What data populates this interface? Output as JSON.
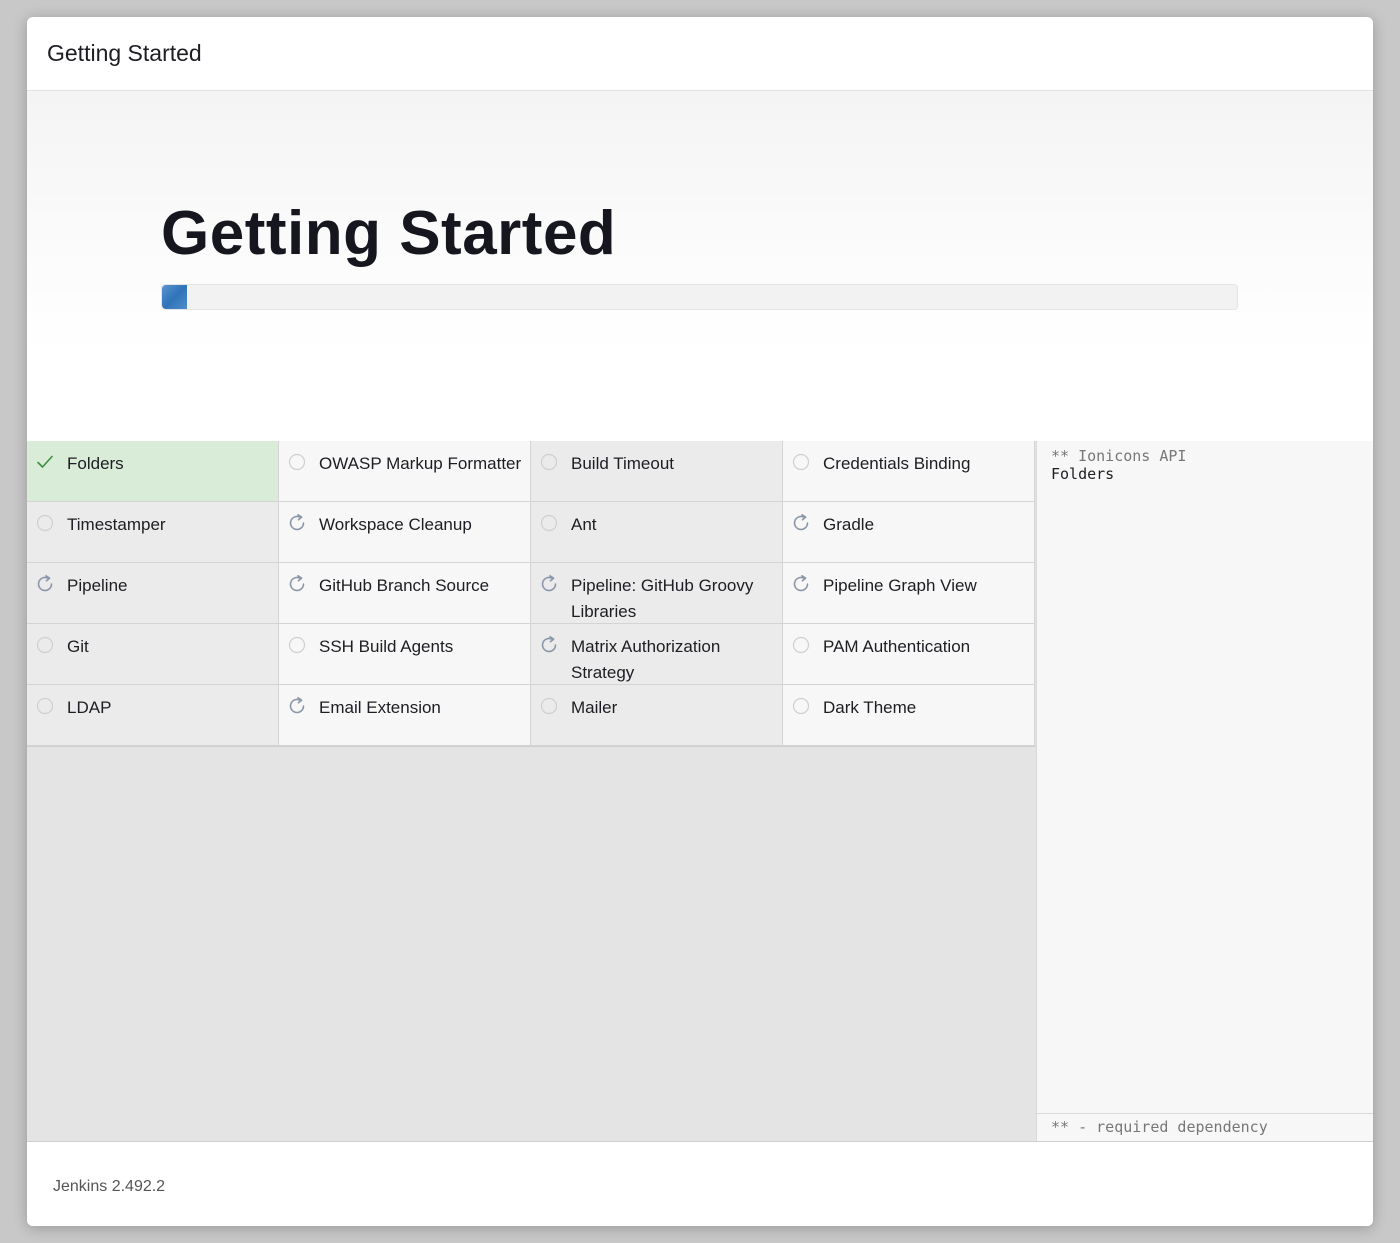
{
  "header": {
    "title": "Getting Started"
  },
  "hero": {
    "title": "Getting Started",
    "progress": 0.023
  },
  "plugins": [
    {
      "label": "Folders",
      "status": "installed",
      "icon": "checkmark-icon"
    },
    {
      "label": "OWASP Markup Formatter",
      "status": "pending",
      "icon": "circle-icon"
    },
    {
      "label": "Build Timeout",
      "status": "pending",
      "icon": "circle-icon"
    },
    {
      "label": "Credentials Binding",
      "status": "pending",
      "icon": "circle-icon"
    },
    {
      "label": "Timestamper",
      "status": "pending",
      "icon": "circle-icon"
    },
    {
      "label": "Workspace Cleanup",
      "status": "installing",
      "icon": "refresh-icon"
    },
    {
      "label": "Ant",
      "status": "pending",
      "icon": "circle-icon"
    },
    {
      "label": "Gradle",
      "status": "installing",
      "icon": "refresh-icon"
    },
    {
      "label": "Pipeline",
      "status": "installing",
      "icon": "refresh-icon"
    },
    {
      "label": "GitHub Branch Source",
      "status": "installing",
      "icon": "refresh-icon"
    },
    {
      "label": "Pipeline: GitHub Groovy Libraries",
      "status": "installing",
      "icon": "refresh-icon"
    },
    {
      "label": "Pipeline Graph View",
      "status": "installing",
      "icon": "refresh-icon"
    },
    {
      "label": "Git",
      "status": "pending",
      "icon": "circle-icon"
    },
    {
      "label": "SSH Build Agents",
      "status": "pending",
      "icon": "circle-icon"
    },
    {
      "label": "Matrix Authorization Strategy",
      "status": "installing",
      "icon": "refresh-icon"
    },
    {
      "label": "PAM Authentication",
      "status": "pending",
      "icon": "circle-icon"
    },
    {
      "label": "LDAP",
      "status": "pending",
      "icon": "circle-icon"
    },
    {
      "label": "Email Extension",
      "status": "installing",
      "icon": "refresh-icon"
    },
    {
      "label": "Mailer",
      "status": "pending",
      "icon": "circle-icon"
    },
    {
      "label": "Dark Theme",
      "status": "pending",
      "icon": "circle-icon"
    }
  ],
  "install_log": {
    "lines": [
      {
        "text": "** Ionicons API",
        "kind": "dependency"
      },
      {
        "text": "Folders",
        "kind": "plugin"
      }
    ],
    "legend": "** - required dependency"
  },
  "footer": {
    "version": "Jenkins 2.492.2"
  },
  "colors": {
    "installed_bg": "#d9ecd7",
    "progress_accent": "#3a7cc0",
    "check_color": "#3f8f3f",
    "icon_color": "#8a97a8"
  }
}
